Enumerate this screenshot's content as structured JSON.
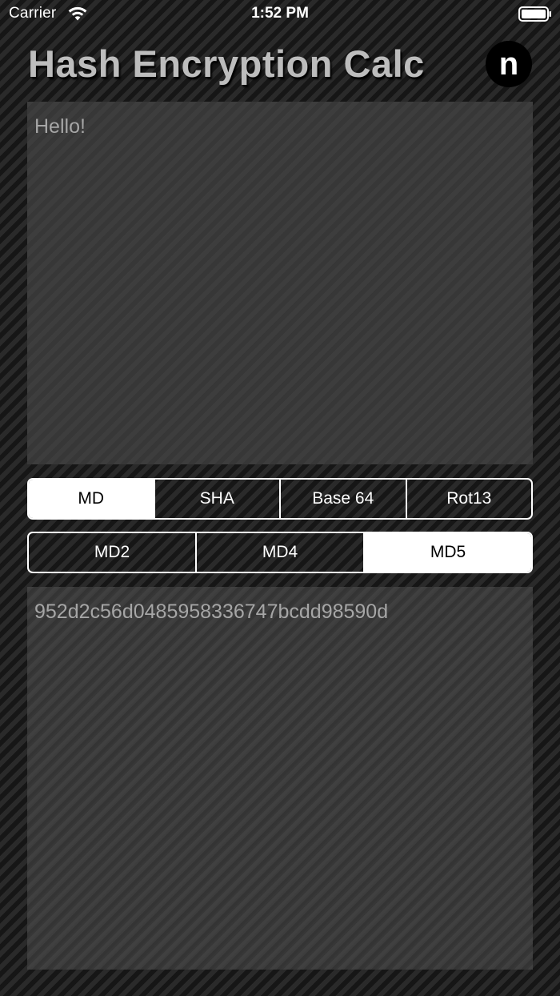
{
  "status_bar": {
    "carrier": "Carrier",
    "time": "1:52 PM",
    "wifi_icon": "wifi-icon",
    "battery_icon": "battery-icon"
  },
  "header": {
    "title": "Hash Encryption Calc",
    "logo_letter": "n"
  },
  "input": {
    "value": "Hello!"
  },
  "algorithm_families": {
    "items": [
      {
        "label": "MD",
        "selected": true
      },
      {
        "label": "SHA",
        "selected": false
      },
      {
        "label": "Base 64",
        "selected": false
      },
      {
        "label": "Rot13",
        "selected": false
      }
    ]
  },
  "algorithm_variants": {
    "items": [
      {
        "label": "MD2",
        "selected": false
      },
      {
        "label": "MD4",
        "selected": false
      },
      {
        "label": "MD5",
        "selected": true
      }
    ]
  },
  "output": {
    "value": "952d2c56d0485958336747bcdd98590d"
  },
  "colors": {
    "background": "#1f1f1f",
    "title_text": "#bdbdbd",
    "field_text": "#a6a6a6",
    "selected_segment": "#ffffff"
  }
}
